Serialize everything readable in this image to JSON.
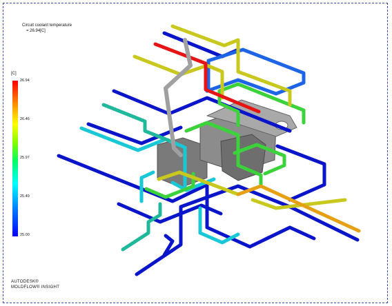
{
  "legend": {
    "title_line1": "Circuit coolant temperature",
    "title_line2": "= 26.94[C]",
    "unit": "[C]",
    "ticks": [
      "26.94",
      "26.46",
      "25.97",
      "25.49",
      "25.00"
    ],
    "colors": {
      "max": "#ff0000",
      "high": "#c8c800",
      "mid": "#33cc33",
      "low_mid": "#00c8c8",
      "min": "#0000cc"
    }
  },
  "brand": {
    "line1": "AUTODESK®",
    "line2": "MOLDFLOW® INSIGHT"
  }
}
